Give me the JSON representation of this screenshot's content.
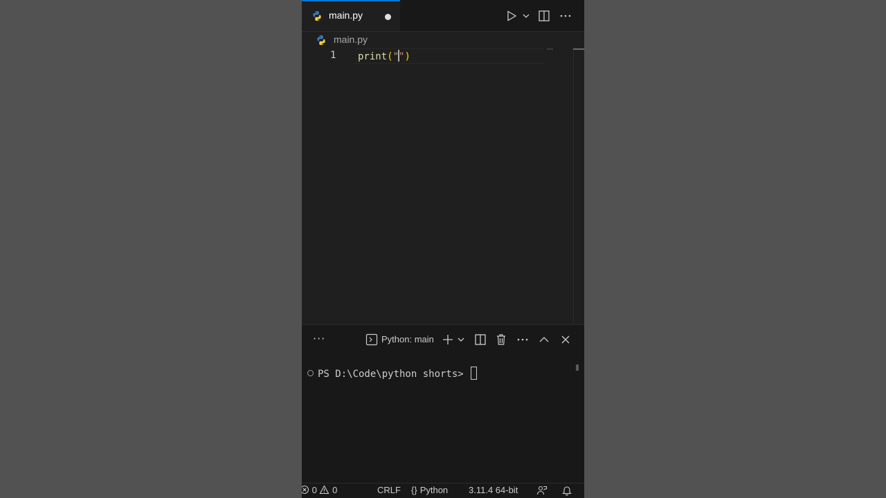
{
  "tab": {
    "label": "main.py"
  },
  "breadcrumb": {
    "file": "main.py"
  },
  "editor": {
    "line_number": "1",
    "code": {
      "fn": "print",
      "open": "(",
      "str_open": "\"",
      "str_close": "\"",
      "close": ")"
    }
  },
  "panel": {
    "more": "···",
    "terminal_tab": "Python: main",
    "prompt": "PS D:\\Code\\python shorts> "
  },
  "statusbar": {
    "errors": "0",
    "warnings": "0",
    "eol": "CRLF",
    "language": "Python",
    "interpreter": "3.11.4 64-bit"
  },
  "icons": [
    "python-file-icon",
    "run-icon",
    "chevron-down-icon",
    "split-editor-icon",
    "more-actions-icon",
    "terminal-icon",
    "plus-icon",
    "trash-icon",
    "chevron-up-icon",
    "close-icon",
    "error-icon",
    "warning-icon",
    "braces-icon",
    "feedback-icon",
    "bell-icon"
  ]
}
